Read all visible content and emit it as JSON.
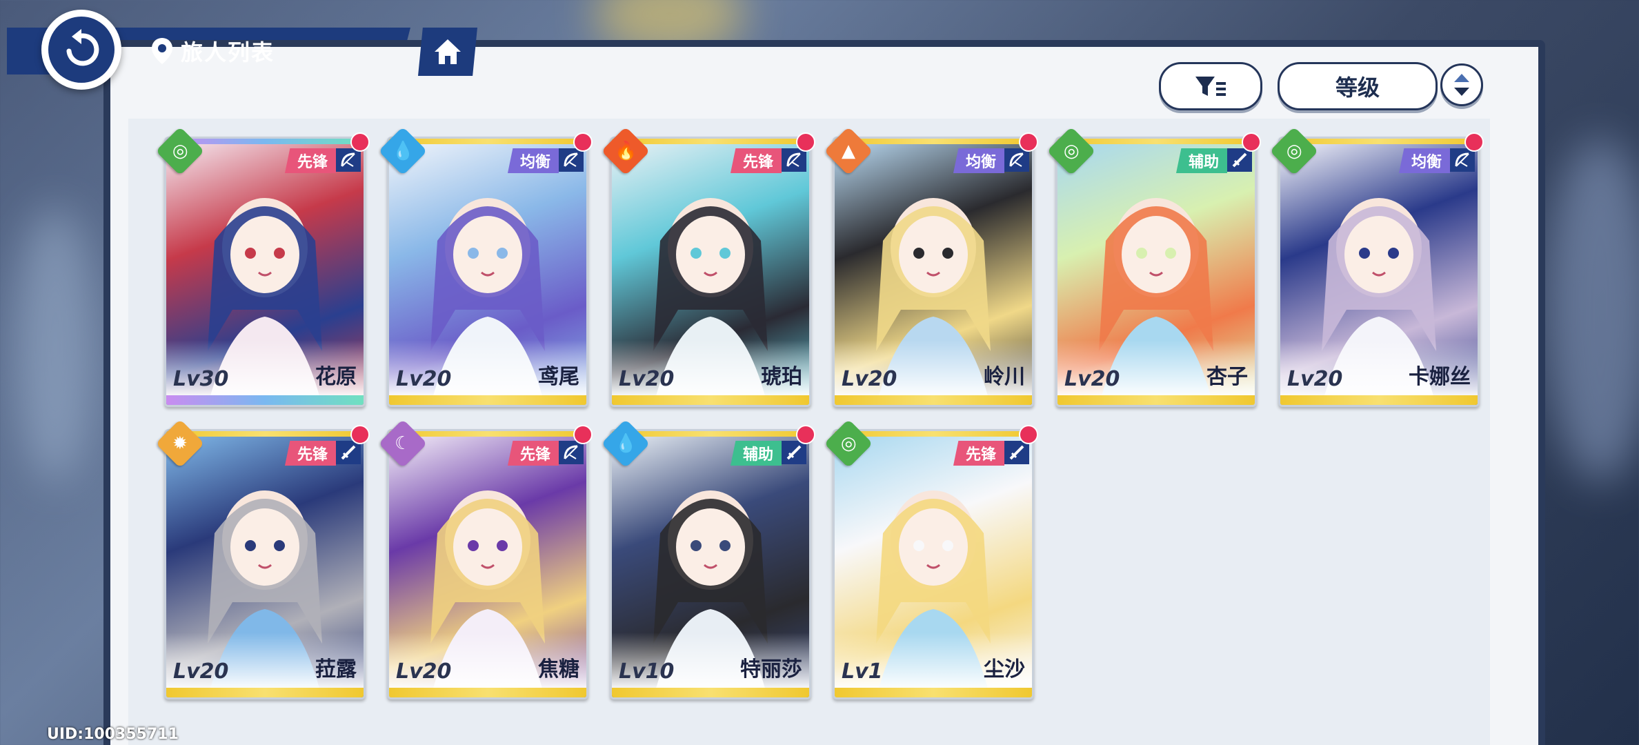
{
  "header": {
    "title": "旅人列表"
  },
  "controls": {
    "sort_label": "等级"
  },
  "uid": "UID:100355711",
  "colors": {
    "nav_blue": "#1d3b7d",
    "role_vanguard": "#e8557a",
    "role_balance": "#7a6ad8",
    "role_support": "#3dbf8f",
    "rainbow_frame": "#c98cf0",
    "gold_frame": "#f0d040",
    "notify_dot": "#e8305a"
  },
  "cards": [
    {
      "name": "花原",
      "level": "Lv30",
      "role": "先锋",
      "role_color": "#e8557a",
      "weapon": "bow-icon",
      "element": "wind-icon",
      "element_color": "#4cae4c",
      "element_glyph": "◎",
      "frame": "rainbow",
      "art": [
        "#2a3f8f",
        "#c63a4a",
        "#f4e8f0"
      ]
    },
    {
      "name": "鸢尾",
      "level": "Lv20",
      "role": "均衡",
      "role_color": "#7a6ad8",
      "weapon": "bow-icon",
      "element": "water-icon",
      "element_color": "#35a6e8",
      "element_glyph": "💧",
      "frame": "gold",
      "art": [
        "#6a5cc8",
        "#8ab8e8",
        "#f0f4fa"
      ]
    },
    {
      "name": "琥珀",
      "level": "Lv20",
      "role": "先锋",
      "role_color": "#e8557a",
      "weapon": "bow-icon",
      "element": "fire-icon",
      "element_color": "#ee5a2a",
      "element_glyph": "🔥",
      "frame": "gold",
      "art": [
        "#2a2a34",
        "#60c8d8",
        "#e8f0f4"
      ]
    },
    {
      "name": "岭川",
      "level": "Lv20",
      "role": "均衡",
      "role_color": "#7a6ad8",
      "weapon": "bow-icon",
      "element": "earth-icon",
      "element_color": "#ee7a3a",
      "element_glyph": "▲",
      "frame": "gold",
      "art": [
        "#f0d888",
        "#2a2a2e",
        "#b8d8f0"
      ]
    },
    {
      "name": "杏子",
      "level": "Lv20",
      "role": "辅助",
      "role_color": "#3dbf8f",
      "weapon": "sword-icon",
      "element": "wind-icon",
      "element_color": "#4cae4c",
      "element_glyph": "◎",
      "frame": "gold",
      "art": [
        "#f07a4a",
        "#d8f0b0",
        "#a8d8f0"
      ]
    },
    {
      "name": "卡娜丝",
      "level": "Lv20",
      "role": "均衡",
      "role_color": "#7a6ad8",
      "weapon": "bow-icon",
      "element": "wind-icon",
      "element_color": "#4cae4c",
      "element_glyph": "◎",
      "frame": "gold",
      "art": [
        "#c8b8d8",
        "#2a3a8a",
        "#f4f4fa"
      ]
    },
    {
      "name": "菈露",
      "level": "Lv20",
      "role": "先锋",
      "role_color": "#e8557a",
      "weapon": "sword-icon",
      "element": "light-icon",
      "element_color": "#f0a83a",
      "element_glyph": "✹",
      "frame": "gold",
      "art": [
        "#b0b0b8",
        "#2a3a7a",
        "#80b8e8"
      ]
    },
    {
      "name": "焦糖",
      "level": "Lv20",
      "role": "先锋",
      "role_color": "#e8557a",
      "weapon": "bow-icon",
      "element": "dark-icon",
      "element_color": "#a86ac8",
      "element_glyph": "☾",
      "frame": "gold",
      "art": [
        "#f0d080",
        "#6a3aa8",
        "#f4eef8"
      ]
    },
    {
      "name": "特丽莎",
      "level": "Lv10",
      "role": "辅助",
      "role_color": "#3dbf8f",
      "weapon": "sword-icon",
      "element": "water-icon",
      "element_color": "#35a6e8",
      "element_glyph": "💧",
      "frame": "gold",
      "art": [
        "#2a2a2e",
        "#3a4a7a",
        "#e8eef4"
      ]
    },
    {
      "name": "尘沙",
      "level": "Lv1",
      "role": "先锋",
      "role_color": "#e8557a",
      "weapon": "sword-icon",
      "element": "wind-icon",
      "element_color": "#4cae4c",
      "element_glyph": "◎",
      "frame": "gold",
      "art": [
        "#f4d880",
        "#f8f8fa",
        "#a8d8f0"
      ]
    }
  ]
}
